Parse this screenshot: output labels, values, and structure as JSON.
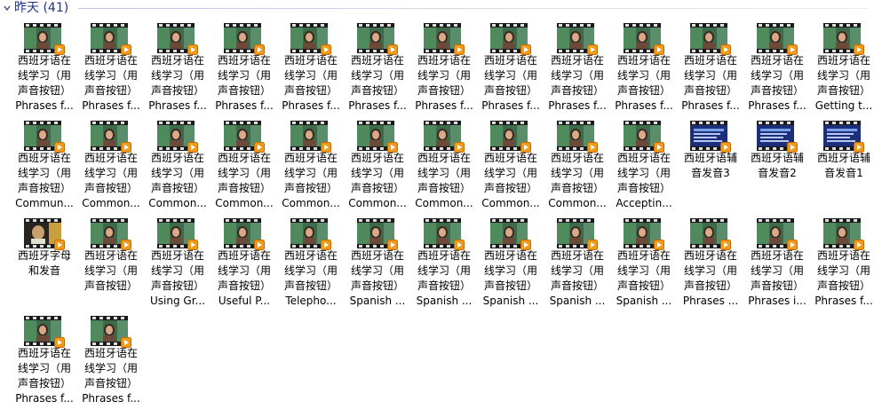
{
  "group": {
    "title": "昨天 (41)"
  },
  "items": [
    {
      "lines": [
        "西班牙语在",
        "线学习（用",
        "声音按钮）",
        "Phrases f..."
      ],
      "thumb": "woman-video-thumbnail-icon"
    },
    {
      "lines": [
        "西班牙语在",
        "线学习（用",
        "声音按钮）",
        "Phrases f..."
      ],
      "thumb": "woman-video-thumbnail-icon"
    },
    {
      "lines": [
        "西班牙语在",
        "线学习（用",
        "声音按钮）",
        "Phrases f..."
      ],
      "thumb": "woman-video-thumbnail-icon"
    },
    {
      "lines": [
        "西班牙语在",
        "线学习（用",
        "声音按钮）",
        "Phrases f..."
      ],
      "thumb": "woman-video-thumbnail-icon"
    },
    {
      "lines": [
        "西班牙语在",
        "线学习（用",
        "声音按钮）",
        "Phrases f..."
      ],
      "thumb": "woman-video-thumbnail-icon"
    },
    {
      "lines": [
        "西班牙语在",
        "线学习（用",
        "声音按钮）",
        "Phrases f..."
      ],
      "thumb": "woman-video-thumbnail-icon"
    },
    {
      "lines": [
        "西班牙语在",
        "线学习（用",
        "声音按钮）",
        "Phrases f..."
      ],
      "thumb": "woman-video-thumbnail-icon"
    },
    {
      "lines": [
        "西班牙语在",
        "线学习（用",
        "声音按钮）",
        "Phrases f..."
      ],
      "thumb": "woman-video-thumbnail-icon"
    },
    {
      "lines": [
        "西班牙语在",
        "线学习（用",
        "声音按钮）",
        "Phrases f..."
      ],
      "thumb": "woman-video-thumbnail-icon"
    },
    {
      "lines": [
        "西班牙语在",
        "线学习（用",
        "声音按钮）",
        "Phrases f..."
      ],
      "thumb": "woman-video-thumbnail-icon"
    },
    {
      "lines": [
        "西班牙语在",
        "线学习（用",
        "声音按钮）",
        "Phrases f..."
      ],
      "thumb": "woman-video-thumbnail-icon"
    },
    {
      "lines": [
        "西班牙语在",
        "线学习（用",
        "声音按钮）",
        "Phrases f..."
      ],
      "thumb": "woman-video-thumbnail-icon"
    },
    {
      "lines": [
        "西班牙语在",
        "线学习（用",
        "声音按钮）",
        "Getting t..."
      ],
      "thumb": "woman-video-thumbnail-icon"
    },
    {
      "lines": [
        "西班牙语在",
        "线学习（用",
        "声音按钮）",
        "Commun..."
      ],
      "thumb": "woman-video-thumbnail-icon"
    },
    {
      "lines": [
        "西班牙语在",
        "线学习（用",
        "声音按钮）",
        "Common..."
      ],
      "thumb": "woman-video-thumbnail-icon"
    },
    {
      "lines": [
        "西班牙语在",
        "线学习（用",
        "声音按钮）",
        "Common..."
      ],
      "thumb": "woman-video-thumbnail-icon"
    },
    {
      "lines": [
        "西班牙语在",
        "线学习（用",
        "声音按钮）",
        "Common..."
      ],
      "thumb": "woman-video-thumbnail-icon"
    },
    {
      "lines": [
        "西班牙语在",
        "线学习（用",
        "声音按钮）",
        "Common..."
      ],
      "thumb": "woman-video-thumbnail-icon"
    },
    {
      "lines": [
        "西班牙语在",
        "线学习（用",
        "声音按钮）",
        "Common..."
      ],
      "thumb": "woman-video-thumbnail-icon"
    },
    {
      "lines": [
        "西班牙语在",
        "线学习（用",
        "声音按钮）",
        "Common..."
      ],
      "thumb": "woman-video-thumbnail-icon"
    },
    {
      "lines": [
        "西班牙语在",
        "线学习（用",
        "声音按钮）",
        "Common..."
      ],
      "thumb": "woman-video-thumbnail-icon"
    },
    {
      "lines": [
        "西班牙语在",
        "线学习（用",
        "声音按钮）",
        "Common..."
      ],
      "thumb": "woman-video-thumbnail-icon"
    },
    {
      "lines": [
        "西班牙语在",
        "线学习（用",
        "声音按钮）",
        "Acceptin..."
      ],
      "thumb": "woman-video-thumbnail-icon"
    },
    {
      "lines": [
        "西班牙语辅",
        "音发音3"
      ],
      "thumb": "blue-slide-video-thumbnail-icon"
    },
    {
      "lines": [
        "西班牙语辅",
        "音发音2"
      ],
      "thumb": "blue-slide-video-thumbnail-icon"
    },
    {
      "lines": [
        "西班牙语辅",
        "音发音1"
      ],
      "thumb": "blue-slide-video-thumbnail-icon"
    },
    {
      "lines": [
        "西班牙字母",
        "和发音"
      ],
      "thumb": "man-video-thumbnail-icon"
    },
    {
      "lines": [
        "西班牙语在",
        "线学习（用",
        "声音按钮）"
      ],
      "thumb": "woman-video-thumbnail-icon"
    },
    {
      "lines": [
        "西班牙语在",
        "线学习（用",
        "声音按钮）",
        "Using Gr..."
      ],
      "thumb": "woman-video-thumbnail-icon"
    },
    {
      "lines": [
        "西班牙语在",
        "线学习（用",
        "声音按钮）",
        "Useful P..."
      ],
      "thumb": "woman-video-thumbnail-icon"
    },
    {
      "lines": [
        "西班牙语在",
        "线学习（用",
        "声音按钮）",
        "Telepho..."
      ],
      "thumb": "woman-video-thumbnail-icon"
    },
    {
      "lines": [
        "西班牙语在",
        "线学习（用",
        "声音按钮）",
        "Spanish ..."
      ],
      "thumb": "woman-video-thumbnail-icon"
    },
    {
      "lines": [
        "西班牙语在",
        "线学习（用",
        "声音按钮）",
        "Spanish ..."
      ],
      "thumb": "woman-video-thumbnail-icon"
    },
    {
      "lines": [
        "西班牙语在",
        "线学习（用",
        "声音按钮）",
        "Spanish ..."
      ],
      "thumb": "woman-video-thumbnail-icon"
    },
    {
      "lines": [
        "西班牙语在",
        "线学习（用",
        "声音按钮）",
        "Spanish ..."
      ],
      "thumb": "woman-video-thumbnail-icon"
    },
    {
      "lines": [
        "西班牙语在",
        "线学习（用",
        "声音按钮）",
        "Spanish ..."
      ],
      "thumb": "woman-video-thumbnail-icon"
    },
    {
      "lines": [
        "西班牙语在",
        "线学习（用",
        "声音按钮）",
        "Phrases ..."
      ],
      "thumb": "woman-video-thumbnail-icon"
    },
    {
      "lines": [
        "西班牙语在",
        "线学习（用",
        "声音按钮）",
        "Phrases i..."
      ],
      "thumb": "woman-video-thumbnail-icon"
    },
    {
      "lines": [
        "西班牙语在",
        "线学习（用",
        "声音按钮）",
        "Phrases f..."
      ],
      "thumb": "woman-video-thumbnail-icon"
    },
    {
      "lines": [
        "西班牙语在",
        "线学习（用",
        "声音按钮）",
        "Phrases f..."
      ],
      "thumb": "woman-video-thumbnail-icon"
    },
    {
      "lines": [
        "西班牙语在",
        "线学习（用",
        "声音按钮）",
        "Phrases f..."
      ],
      "thumb": "woman-video-thumbnail-icon"
    }
  ]
}
